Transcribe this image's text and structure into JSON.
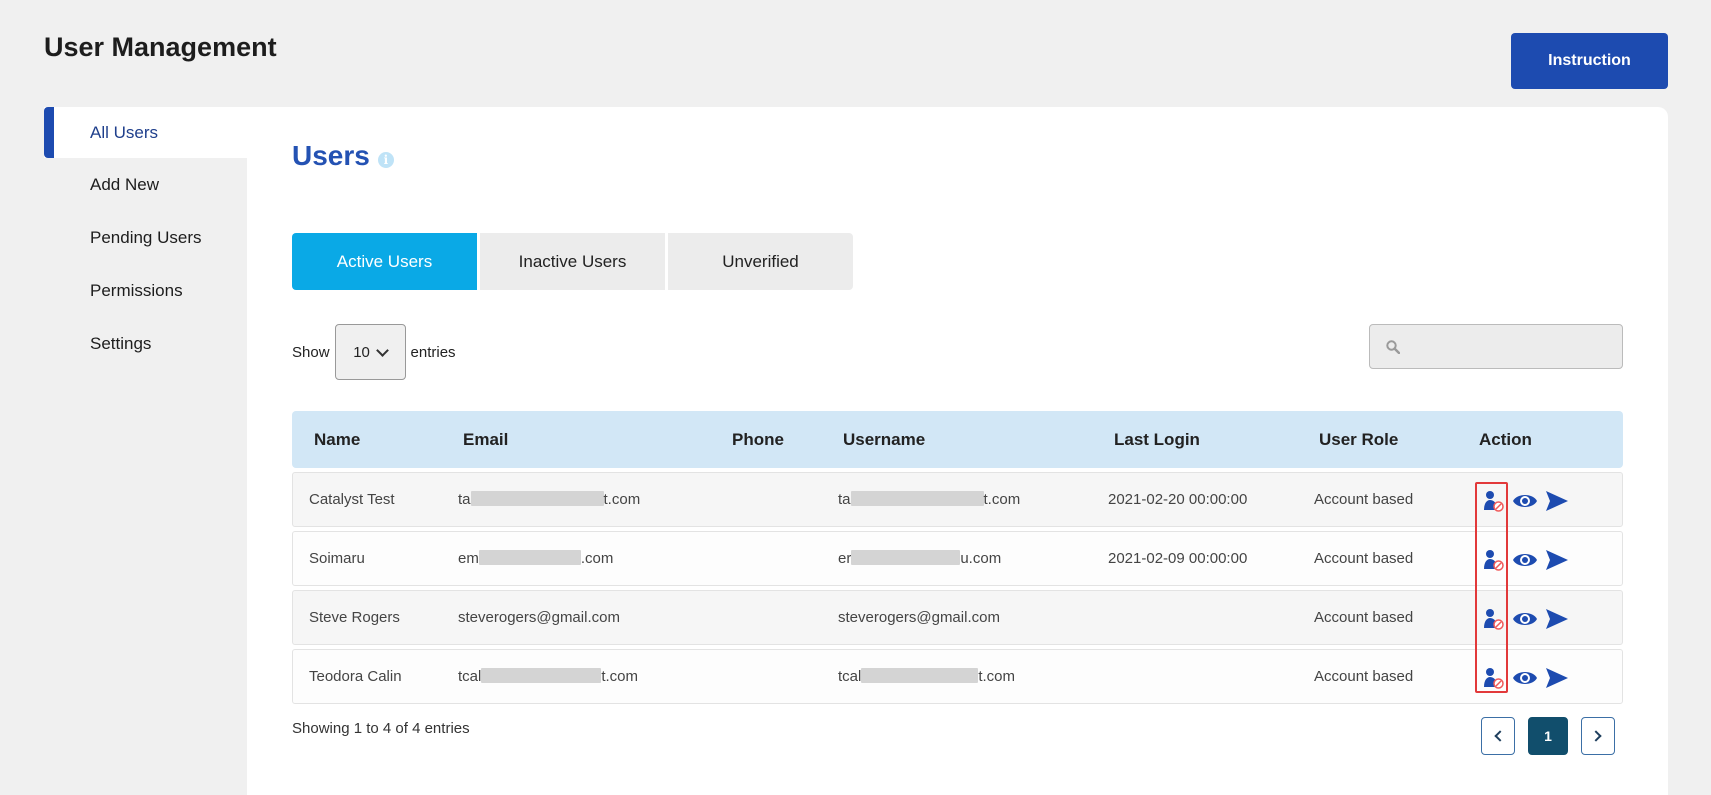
{
  "page": {
    "title": "User Management"
  },
  "header": {
    "instruction_label": "Instruction"
  },
  "sidebar": {
    "items": [
      {
        "label": "All Users",
        "active": true
      },
      {
        "label": "Add New"
      },
      {
        "label": "Pending Users"
      },
      {
        "label": "Permissions"
      },
      {
        "label": "Settings"
      }
    ]
  },
  "main": {
    "heading": "Users",
    "info_icon": "info-icon",
    "tabs": [
      {
        "label": "Active Users",
        "active": true
      },
      {
        "label": "Inactive Users"
      },
      {
        "label": "Unverified"
      }
    ],
    "show_label": "Show",
    "entries_value": "10",
    "entries_label": "entries",
    "search": {
      "placeholder": ""
    }
  },
  "table": {
    "columns": [
      "Name",
      "Email",
      "Phone",
      "Username",
      "Last Login",
      "User Role",
      "Action"
    ],
    "rows": [
      {
        "name": "Catalyst Test",
        "email_prefix": "ta",
        "email_suffix": "t.com",
        "phone": "",
        "username_prefix": "ta",
        "username_suffix": "t.com",
        "last_login": "2021-02-20 00:00:00",
        "role": "Account based"
      },
      {
        "name": "Soimaru",
        "email_prefix": "em",
        "email_suffix": ".com",
        "phone": "",
        "username_prefix": "er",
        "username_suffix": "u.com",
        "last_login": "2021-02-09 00:00:00",
        "role": "Account based"
      },
      {
        "name": "Steve Rogers",
        "email_prefix": "steverogers@gmail.com",
        "email_suffix": "",
        "phone": "",
        "username_prefix": "steverogers@gmail.com",
        "username_suffix": "",
        "last_login": "",
        "role": "Account based"
      },
      {
        "name": "Teodora Calin",
        "email_prefix": "tcal",
        "email_suffix": "t.com",
        "phone": "",
        "username_prefix": "tcal",
        "username_suffix": "t.com",
        "last_login": "",
        "role": "Account based"
      }
    ],
    "action_icons": [
      "deactivate-user-icon",
      "view-eye-icon",
      "send-icon"
    ]
  },
  "footer": {
    "showing_text": "Showing 1 to 4 of 4 entries",
    "current_page": "1"
  },
  "colors": {
    "primary": "#1d4bb0",
    "tab_active": "#0aa9e6",
    "table_header": "#d2e7f6",
    "highlight": "#e2393a",
    "pager_current": "#114e6c"
  }
}
